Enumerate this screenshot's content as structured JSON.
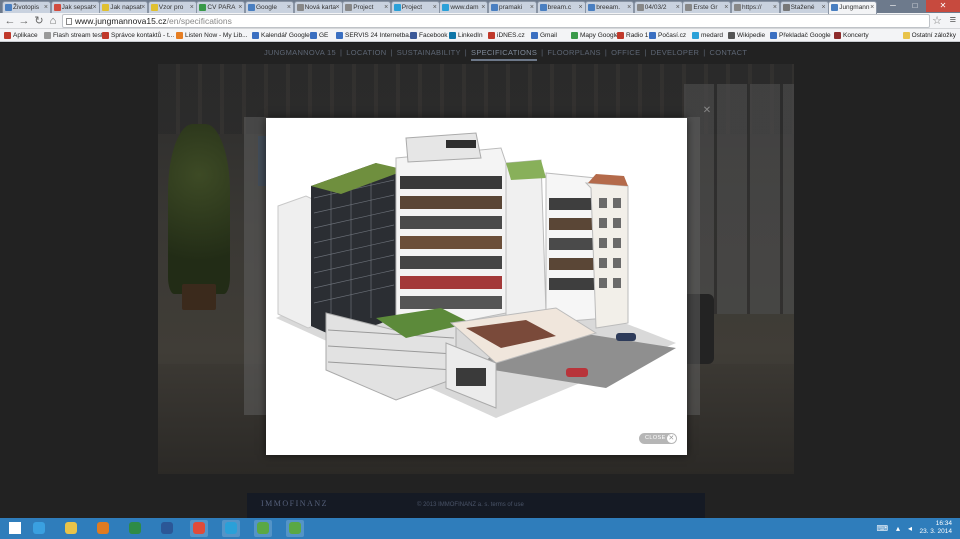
{
  "browser": {
    "tabs": [
      {
        "label": "Životopis",
        "color": "#4a7fc1"
      },
      {
        "label": "Jak sepsat",
        "color": "#d24b3d"
      },
      {
        "label": "Jak napsat",
        "color": "#e0c030"
      },
      {
        "label": "Vzor pro",
        "color": "#e0c030"
      },
      {
        "label": "CV PARA",
        "color": "#3a9a4a"
      },
      {
        "label": "Google",
        "color": "#4a7fc1"
      },
      {
        "label": "Nová karta",
        "color": "#888888"
      },
      {
        "label": "Project",
        "color": "#888888"
      },
      {
        "label": "Project",
        "color": "#2aa0d8"
      },
      {
        "label": "www.dam",
        "color": "#2aa0d8"
      },
      {
        "label": "pramaki",
        "color": "#4a7fc1"
      },
      {
        "label": "bream.c",
        "color": "#4a7fc1"
      },
      {
        "label": "breeam.",
        "color": "#4a7fc1"
      },
      {
        "label": "04/03/2",
        "color": "#888888"
      },
      {
        "label": "Erste Gr",
        "color": "#888888"
      },
      {
        "label": "https://",
        "color": "#888888"
      },
      {
        "label": "Stažené",
        "color": "#777777"
      },
      {
        "label": "Jungmann",
        "color": "#4a7fc1"
      }
    ],
    "active_tab_index": 17,
    "url_host": "www.jungmannova15.cz",
    "url_path": "/en/specifications",
    "bookmarks": [
      {
        "label": "Aplikace",
        "color": "#c0392b"
      },
      {
        "label": "Flash stream test",
        "color": "#999999"
      },
      {
        "label": "Správce kontaktů - t...",
        "color": "#c0392b"
      },
      {
        "label": "Listen Now - My Lib...",
        "color": "#e67e22"
      },
      {
        "label": "Kalendář Google",
        "color": "#3a6fc1"
      },
      {
        "label": "GE",
        "color": "#3a6fc1"
      },
      {
        "label": "SERVIS 24 Internetba...",
        "color": "#3a6fc1"
      },
      {
        "label": "Facebook",
        "color": "#3b5998"
      },
      {
        "label": "LinkedIn",
        "color": "#0e76a8"
      },
      {
        "label": "iDNES.cz",
        "color": "#c0392b"
      },
      {
        "label": "Gmail",
        "color": "#3a6fc1"
      },
      {
        "label": "Mapy Google",
        "color": "#3a9a4a"
      },
      {
        "label": "Radio 1",
        "color": "#c0392b"
      },
      {
        "label": "Počasí.cz",
        "color": "#3a6fc1"
      },
      {
        "label": "medard",
        "color": "#2aa0d8"
      },
      {
        "label": "Wikipedie",
        "color": "#555555"
      },
      {
        "label": "Překladač Google",
        "color": "#3a6fc1"
      },
      {
        "label": "Koncerty",
        "color": "#8e2c2c"
      }
    ],
    "other_bookmarks": "Ostatní záložky"
  },
  "site": {
    "nav": [
      "JUNGMANNOVA 15",
      "LOCATION",
      "SUSTAINABILITY",
      "SPECIFICATIONS",
      "FLOORPLANS",
      "OFFICE",
      "DEVELOPER",
      "CONTACT"
    ],
    "active_nav": "SPECIFICATIONS",
    "footer_logo": "IMMOFINANZ",
    "footer_copy": "© 2013 IMMOFINANZ a. s. terms of use"
  },
  "lightbox": {
    "close_label": "CLOSE"
  },
  "taskbar": {
    "apps": [
      {
        "name": "start-icon",
        "color": "#ffffff"
      },
      {
        "name": "internet-explorer-icon",
        "color": "#3aa0e0"
      },
      {
        "name": "file-explorer-icon",
        "color": "#e8c34a"
      },
      {
        "name": "outlook-icon",
        "color": "#e07b20"
      },
      {
        "name": "excel-icon",
        "color": "#2e8b46"
      },
      {
        "name": "word-icon",
        "color": "#2b5797"
      },
      {
        "name": "chrome-icon",
        "color": "#e04b3a"
      },
      {
        "name": "app-icon",
        "color": "#2aa0d8"
      },
      {
        "name": "app-icon-2",
        "color": "#5aa845"
      },
      {
        "name": "app-icon-3",
        "color": "#5aa845"
      }
    ],
    "time": "16:34",
    "date": "23. 3. 2014"
  }
}
